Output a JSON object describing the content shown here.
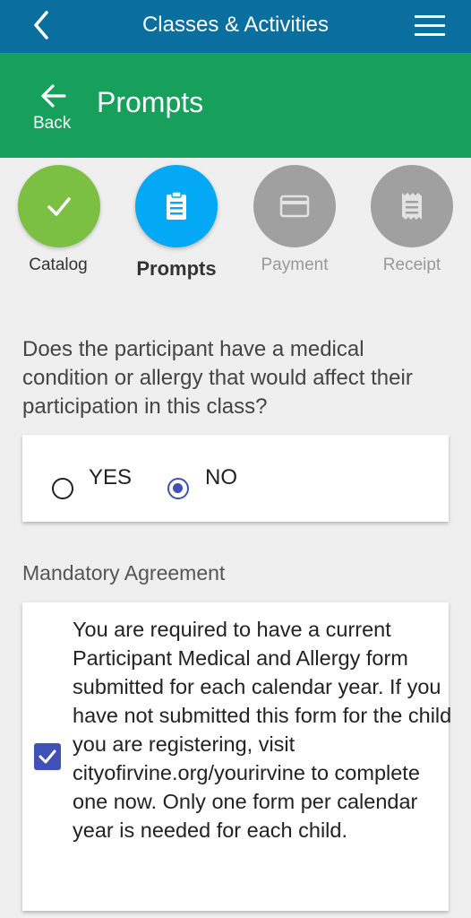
{
  "topbar": {
    "title": "Classes & Activities"
  },
  "header": {
    "back_label": "Back",
    "title": "Prompts"
  },
  "steps": [
    {
      "label": "Catalog",
      "state": "done",
      "icon": "check-icon",
      "color": "#7cc043"
    },
    {
      "label": "Prompts",
      "state": "current",
      "icon": "clipboard-icon",
      "color": "#03a9f4"
    },
    {
      "label": "Payment",
      "state": "upcoming",
      "icon": "credit-card-icon",
      "color": "#a0a0a0"
    },
    {
      "label": "Receipt",
      "state": "upcoming",
      "icon": "receipt-icon",
      "color": "#a0a0a0"
    }
  ],
  "question": {
    "text": "Does the participant have a medical condition or allergy that would affect their participation in this class?",
    "options": [
      {
        "label": "YES",
        "selected": false
      },
      {
        "label": "NO",
        "selected": true
      }
    ]
  },
  "agreement": {
    "title": "Mandatory Agreement",
    "checked": true,
    "text": "You are required to have a current Participant Medical and Allergy form submitted for each calendar year. If you have not submitted this form for the child you are registering, visit cityofirvine.org/yourirvine to complete one now. Only one form per calendar year is needed for each child."
  },
  "colors": {
    "topbar": "#0a6e9e",
    "header": "#17a05b",
    "accent": "#3f51b5"
  }
}
